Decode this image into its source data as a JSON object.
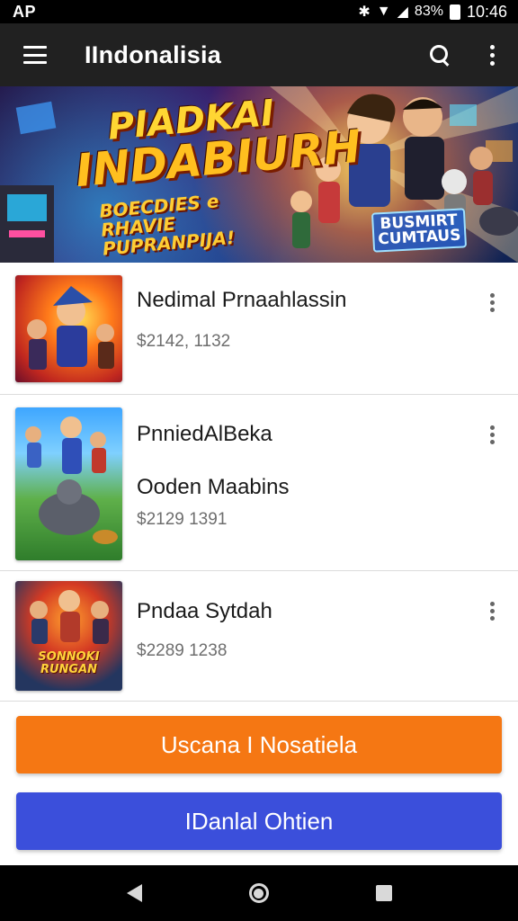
{
  "status_bar": {
    "carrier": "AP",
    "battery": "83%",
    "time": "10:46"
  },
  "app_bar": {
    "title": "IIndonalisia",
    "icons": [
      "menu-icon",
      "search-icon",
      "more-vert-icon"
    ]
  },
  "banner": {
    "title_line1": "PIADKAI",
    "title_line2": "INDABIURH",
    "tagline": "BOECDIES e RHAVIE PUPRANPIJA!",
    "badge": "BUSMIRT CUMTAUS"
  },
  "list": {
    "items": [
      {
        "title": "Nedimal Prnaahlassin",
        "subtitle": "",
        "price": "$2142, 1132"
      },
      {
        "title": "PnniedAlBeka",
        "subtitle": "Ooden Maabins",
        "price": "$2129 1391"
      },
      {
        "title": "Pndaa Sytdah",
        "subtitle": "",
        "price": "$2289 1238",
        "thumb_caption": "SONNOKI RUNGAN"
      }
    ]
  },
  "buttons": {
    "primary_label": "Uscana I Nosatiela",
    "secondary_label": "IDanlal Ohtien"
  },
  "colors": {
    "app_bar": "#212121",
    "primary_button": "#f57713",
    "secondary_button": "#3b4fdb",
    "status_bar": "#000000"
  }
}
